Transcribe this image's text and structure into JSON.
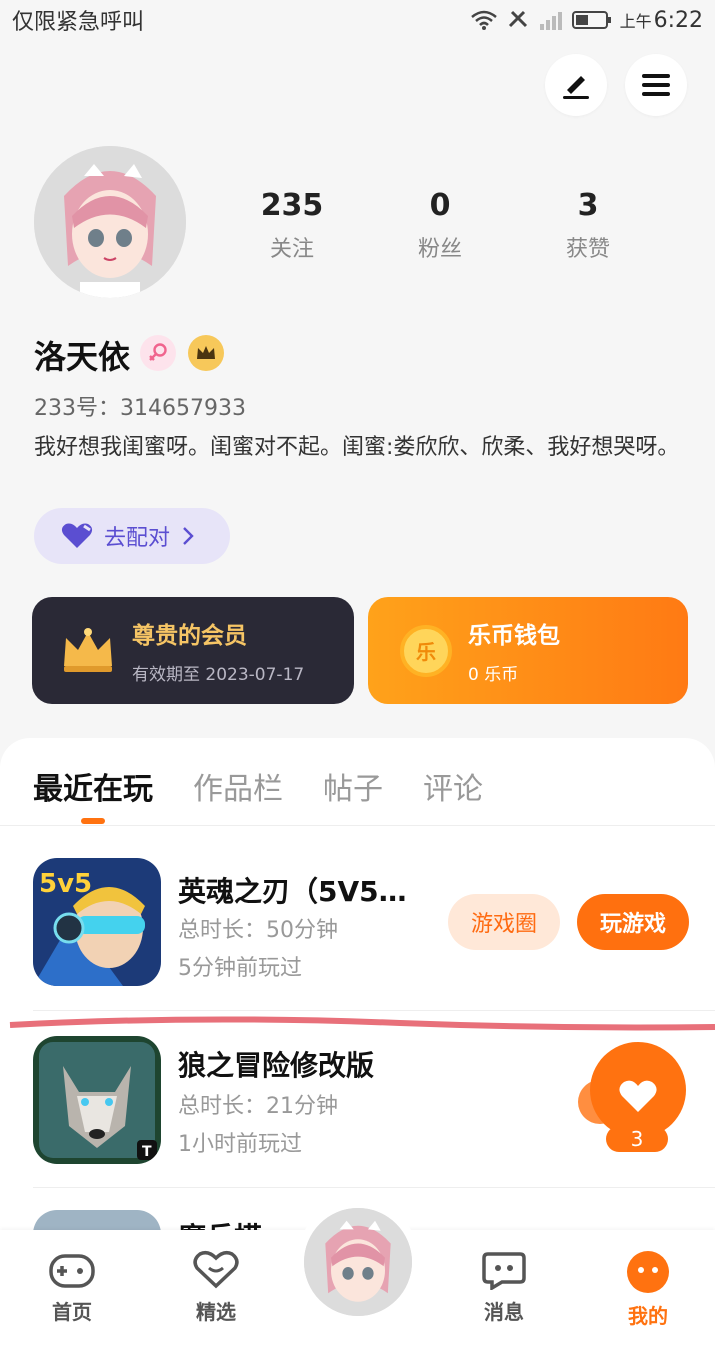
{
  "status_bar": {
    "carrier": "仅限紧急呼叫",
    "time_prefix": "上午",
    "time": "6:22"
  },
  "profile": {
    "name": "洛天依",
    "uid": "233号：314657933",
    "bio": "我好想我闺蜜呀。闺蜜对不起。闺蜜:娄欣欣、欣柔、我好想哭呀。",
    "stats": [
      {
        "value": "235",
        "label": "关注"
      },
      {
        "value": "0",
        "label": "粉丝"
      },
      {
        "value": "3",
        "label": "获赞"
      }
    ],
    "pair_button": "去配对"
  },
  "cards": {
    "vip": {
      "title": "尊贵的会员",
      "subtitle": "有效期至 2023-07-17"
    },
    "wallet": {
      "title": "乐币钱包",
      "subtitle": "0 乐币",
      "coin_glyph": "乐"
    }
  },
  "tabs": [
    "最近在玩",
    "作品栏",
    "帖子",
    "评论"
  ],
  "games": [
    {
      "name": "英魂之刃（5V5英…",
      "duration": "总时长：50分钟",
      "last_played": "5分钟前玩过",
      "circle_button": "游戏圈",
      "play_button": "玩游戏",
      "icon_badge": "5v5"
    },
    {
      "name": "狼之冒险修改版",
      "duration": "总时长：21分钟",
      "last_played": "1小时前玩过",
      "icon_badge": "T"
    },
    {
      "name": "魔兵模拟…",
      "duration": "",
      "last_played": ""
    }
  ],
  "like_float": {
    "count": "3"
  },
  "nav": [
    {
      "label": "首页",
      "icon": "gamepad-icon"
    },
    {
      "label": "精选",
      "icon": "heart-chat-icon"
    },
    {
      "label": "消息",
      "icon": "message-icon"
    },
    {
      "label": "我的",
      "icon": "me-icon"
    }
  ],
  "colors": {
    "accent": "#ff7210",
    "pair": "#5b4ed1",
    "vip_bg": "#2a2936",
    "vip_text": "#f6c565"
  }
}
